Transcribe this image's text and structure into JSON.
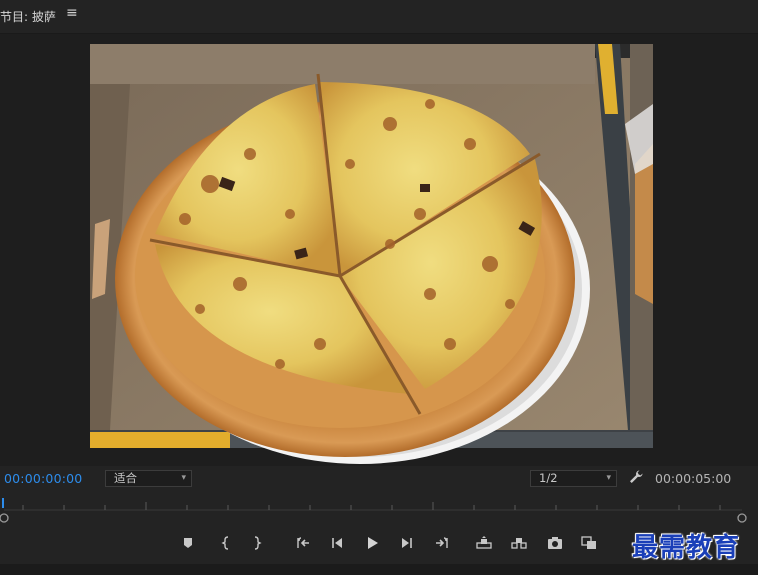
{
  "panel": {
    "title": "节目: 披萨",
    "menu_icon": "hamburger-icon"
  },
  "viewer": {
    "content": "pizza-frame"
  },
  "controls": {
    "current_timecode": "00:00:00:00",
    "zoom_value": "适合",
    "resolution_value": "1/2",
    "duration_timecode": "00:00:05:00",
    "settings_icon": "wrench-icon"
  },
  "transport": {
    "buttons": [
      {
        "name": "add-marker-button",
        "icon": "marker-icon"
      },
      {
        "name": "mark-in-button",
        "icon": "brace-left-icon"
      },
      {
        "name": "mark-out-button",
        "icon": "brace-right-icon"
      },
      {
        "name": "go-to-in-button",
        "icon": "go-to-in-icon"
      },
      {
        "name": "step-back-button",
        "icon": "step-back-icon"
      },
      {
        "name": "play-button",
        "icon": "play-icon"
      },
      {
        "name": "step-forward-button",
        "icon": "step-forward-icon"
      },
      {
        "name": "go-to-out-button",
        "icon": "go-to-out-icon"
      },
      {
        "name": "lift-button",
        "icon": "lift-icon"
      },
      {
        "name": "extract-button",
        "icon": "extract-icon"
      },
      {
        "name": "export-frame-button",
        "icon": "camera-icon"
      },
      {
        "name": "comparison-view-button",
        "icon": "comparison-icon"
      }
    ]
  },
  "watermark": {
    "text": "最需教育"
  },
  "colors": {
    "timecode_blue": "#2d8ceb",
    "background": "#232323",
    "watermark_blue": "#1a3fb8"
  }
}
